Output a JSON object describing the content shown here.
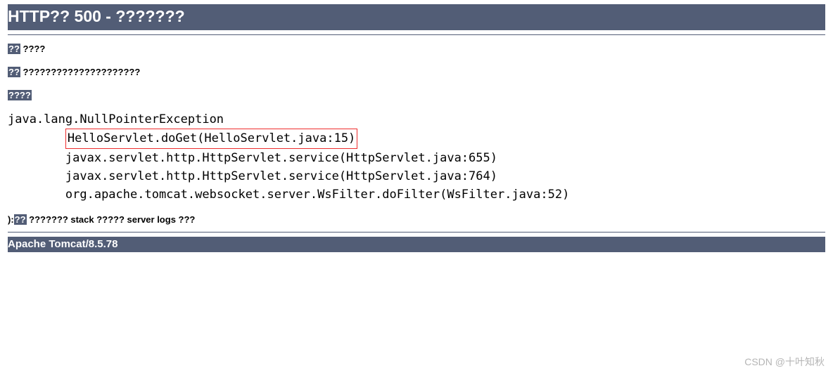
{
  "header": {
    "title": "HTTP?? 500 - ???????"
  },
  "type_line": {
    "label": "??",
    "value": " ????"
  },
  "message_line": {
    "label": "??",
    "value": " ?????????????????????"
  },
  "description_label": {
    "label": "????"
  },
  "stacktrace": {
    "line0": "java.lang.NullPointerException",
    "highlight": "HelloServlet.doGet(HelloServlet.java:15)",
    "line2": "javax.servlet.http.HttpServlet.service(HttpServlet.java:655)",
    "line3": "javax.servlet.http.HttpServlet.service(HttpServlet.java:764)",
    "line4": "org.apache.tomcat.websocket.server.WsFilter.doFilter(WsFilter.java:52)"
  },
  "note_line": {
    "prefix": "):",
    "label": "??",
    "value": " ??????? stack ????? server logs ???"
  },
  "footer": {
    "text": "Apache Tomcat/8.5.78"
  },
  "watermark": "CSDN @十叶知秋"
}
